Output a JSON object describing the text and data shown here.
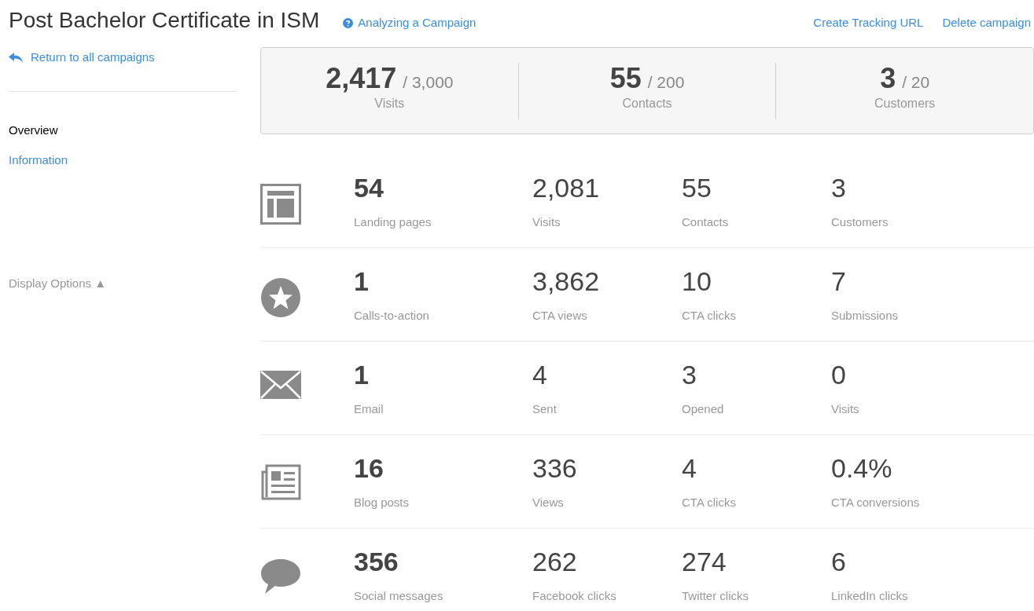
{
  "header": {
    "title": "Post Bachelor Certificate in ISM",
    "help_link": "Analyzing a Campaign",
    "actions": [
      "Create Tracking URL",
      "Delete campaign"
    ]
  },
  "sidebar": {
    "back_link": "Return to all campaigns",
    "nav": [
      {
        "label": "Overview",
        "selected": true
      },
      {
        "label": "Information",
        "selected": false
      }
    ],
    "display_options": "Display Options ▲"
  },
  "goals": [
    {
      "value": "2,417",
      "target": "/ 3,000",
      "label": "Visits"
    },
    {
      "value": "55",
      "target": "/ 200",
      "label": "Contacts"
    },
    {
      "value": "3",
      "target": "/ 20",
      "label": "Customers"
    }
  ],
  "rows": [
    {
      "kind": "landing",
      "metrics": [
        {
          "value": "54",
          "label": "Landing pages"
        },
        {
          "value": "2,081",
          "label": "Visits"
        },
        {
          "value": "55",
          "label": "Contacts"
        },
        {
          "value": "3",
          "label": "Customers"
        }
      ]
    },
    {
      "kind": "cta",
      "metrics": [
        {
          "value": "1",
          "label": "Calls-to-action"
        },
        {
          "value": "3,862",
          "label": "CTA views"
        },
        {
          "value": "10",
          "label": "CTA clicks"
        },
        {
          "value": "7",
          "label": "Submissions"
        }
      ]
    },
    {
      "kind": "email",
      "metrics": [
        {
          "value": "1",
          "label": "Email"
        },
        {
          "value": "4",
          "label": "Sent"
        },
        {
          "value": "3",
          "label": "Opened"
        },
        {
          "value": "0",
          "label": "Visits"
        }
      ]
    },
    {
      "kind": "blog",
      "metrics": [
        {
          "value": "16",
          "label": "Blog posts"
        },
        {
          "value": "336",
          "label": "Views"
        },
        {
          "value": "4",
          "label": "CTA clicks"
        },
        {
          "value": "0.4%",
          "label": "CTA conversions"
        }
      ]
    },
    {
      "kind": "social",
      "metrics": [
        {
          "value": "356",
          "label": "Social messages"
        },
        {
          "value": "262",
          "label": "Facebook clicks"
        },
        {
          "value": "274",
          "label": "Twitter clicks"
        },
        {
          "value": "6",
          "label": "LinkedIn clicks"
        }
      ]
    }
  ]
}
